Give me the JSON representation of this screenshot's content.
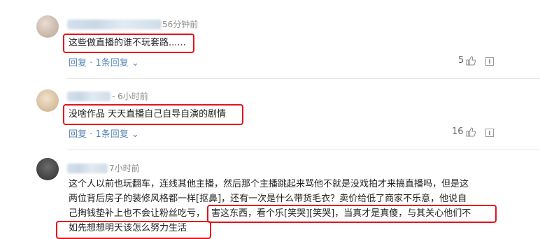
{
  "comments": [
    {
      "time": "56分钟前",
      "text": "这些做直播的谁不玩套路......",
      "reply_label": "回复",
      "reply_count_label": "1条回复",
      "likes": "5"
    },
    {
      "time": "6小时前",
      "text": "没啥作品 天天直播自己自导自演的剧情",
      "reply_label": "回复",
      "reply_count_label": "1条回复",
      "likes": "16"
    },
    {
      "time": "7小时前",
      "line1": "这个人以前也玩翻车，连线其他主播，然后那个主播跳起来骂他不就是没戏拍才来搞直播吗，但是这",
      "line2": "两位背后房子的装修风格都一样[抠鼻]，还有一次是什么带货毛衣？卖价给低了商家不乐意，他说自",
      "line3_plain": "己掏钱垫补上也不会让粉丝吃亏，",
      "line3_highlight": "害这东西，看个乐[笑哭][笑哭]，当真才是真傻，与其关心他们不",
      "line4_highlight": "如先想想明天该怎么努力生活"
    }
  ],
  "reply_separator": "·",
  "dropdown_glyph": "⌄"
}
